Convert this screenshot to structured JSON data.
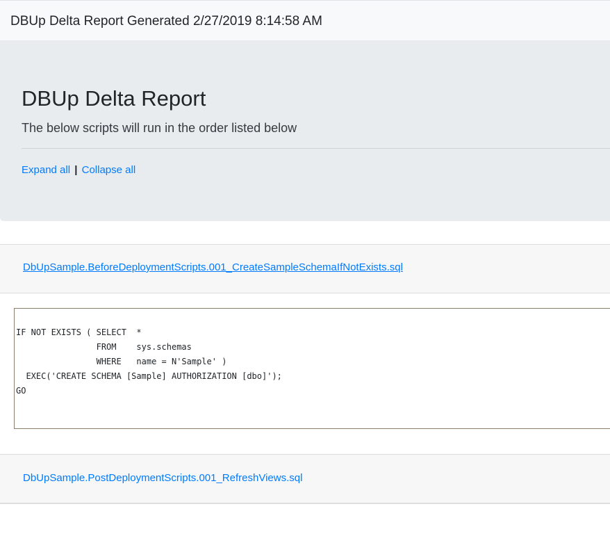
{
  "header": {
    "title": "DBUp Delta Report Generated 2/27/2019 8:14:58 AM"
  },
  "jumbotron": {
    "heading": "DBUp Delta Report",
    "lead": "The below scripts will run in the order listed below",
    "expand_all": "Expand all",
    "separator": "|",
    "collapse_all": "Collapse all"
  },
  "scripts": [
    {
      "name": "DbUpSample.BeforeDeploymentScripts.001_CreateSampleSchemaIfNotExists.sql",
      "expanded": true,
      "code": "IF NOT EXISTS ( SELECT  *\n                FROM    sys.schemas\n                WHERE   name = N'Sample' )\n  EXEC('CREATE SCHEMA [Sample] AUTHORIZATION [dbo]');\nGO"
    },
    {
      "name": "DbUpSample.PostDeploymentScripts.001_RefreshViews.sql",
      "expanded": false
    }
  ],
  "colors": {
    "link": "#007bff",
    "jumbotron_bg": "#e9ecef",
    "header_bg": "#f8f9fa",
    "code_border": "#8b7d6b"
  }
}
